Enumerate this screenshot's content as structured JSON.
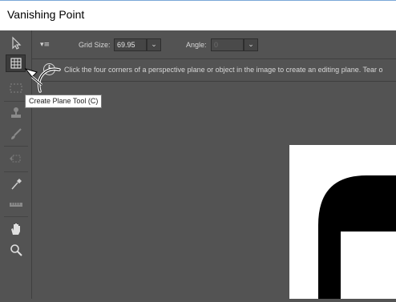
{
  "window": {
    "title": "Vanishing Point"
  },
  "toolbar": {
    "grid_size_label": "Grid Size:",
    "grid_size_value": "69.95",
    "angle_label": "Angle:",
    "angle_value": "0"
  },
  "info": {
    "message": "Click the four corners of a perspective plane or object in the image to create an editing plane. Tear o"
  },
  "tooltip": {
    "text": "Create Plane Tool (C)"
  },
  "tools": [
    {
      "name": "edit-plane-tool",
      "icon": "arrow-icon"
    },
    {
      "name": "create-plane-tool",
      "icon": "grid-icon",
      "active": true
    },
    {
      "name": "marquee-tool",
      "icon": "marquee-icon"
    },
    {
      "name": "stamp-tool",
      "icon": "stamp-icon"
    },
    {
      "name": "brush-tool",
      "icon": "brush-icon"
    },
    {
      "name": "transform-tool",
      "icon": "transform-icon"
    },
    {
      "name": "eyedropper-tool",
      "icon": "eyedropper-icon"
    },
    {
      "name": "measure-tool",
      "icon": "ruler-icon"
    },
    {
      "name": "hand-tool",
      "icon": "hand-icon"
    },
    {
      "name": "zoom-tool",
      "icon": "zoom-icon"
    }
  ],
  "colors": {
    "panel": "#535353",
    "canvas_doc": "#ffffff",
    "doc_shape": "#000000"
  }
}
